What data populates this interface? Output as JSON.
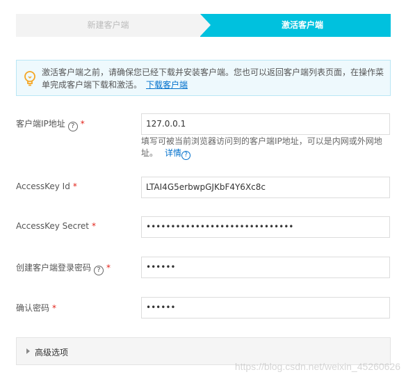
{
  "steps": {
    "step1": "新建客户端",
    "step2": "激活客户端"
  },
  "notice": {
    "text": "激活客户端之前，请确保您已经下载并安装客户端。您也可以返回客户端列表页面，在操作菜单完成客户端下载和激活。",
    "link": "下载客户端"
  },
  "form": {
    "ip_label": "客户端IP地址",
    "ip_value": "127.0.0.1",
    "ip_hint": "填写可被当前浏览器访问到的客户端IP地址，可以是内网或外网地址。",
    "ip_hint_link": "详情",
    "accesskey_id_label": "AccessKey Id",
    "accesskey_id_value": "LTAI4G5erbwpGJKbF4Y6Xc8c",
    "accesskey_secret_label": "AccessKey Secret",
    "accesskey_secret_value": "••••••••••••••••••••••••••••••",
    "login_pwd_label": "创建客户端登录密码",
    "login_pwd_value": "••••••",
    "confirm_pwd_label": "确认密码",
    "confirm_pwd_value": "••••••",
    "required_mark": "*",
    "help_glyph": "?"
  },
  "advanced": {
    "label": "高级选项"
  },
  "watermark": "https://blog.csdn.net/weixin_45260626",
  "colors": {
    "accent": "#00c1de",
    "link": "#0070cc",
    "required": "#e2231a",
    "notice_bg": "#eef9fd"
  }
}
